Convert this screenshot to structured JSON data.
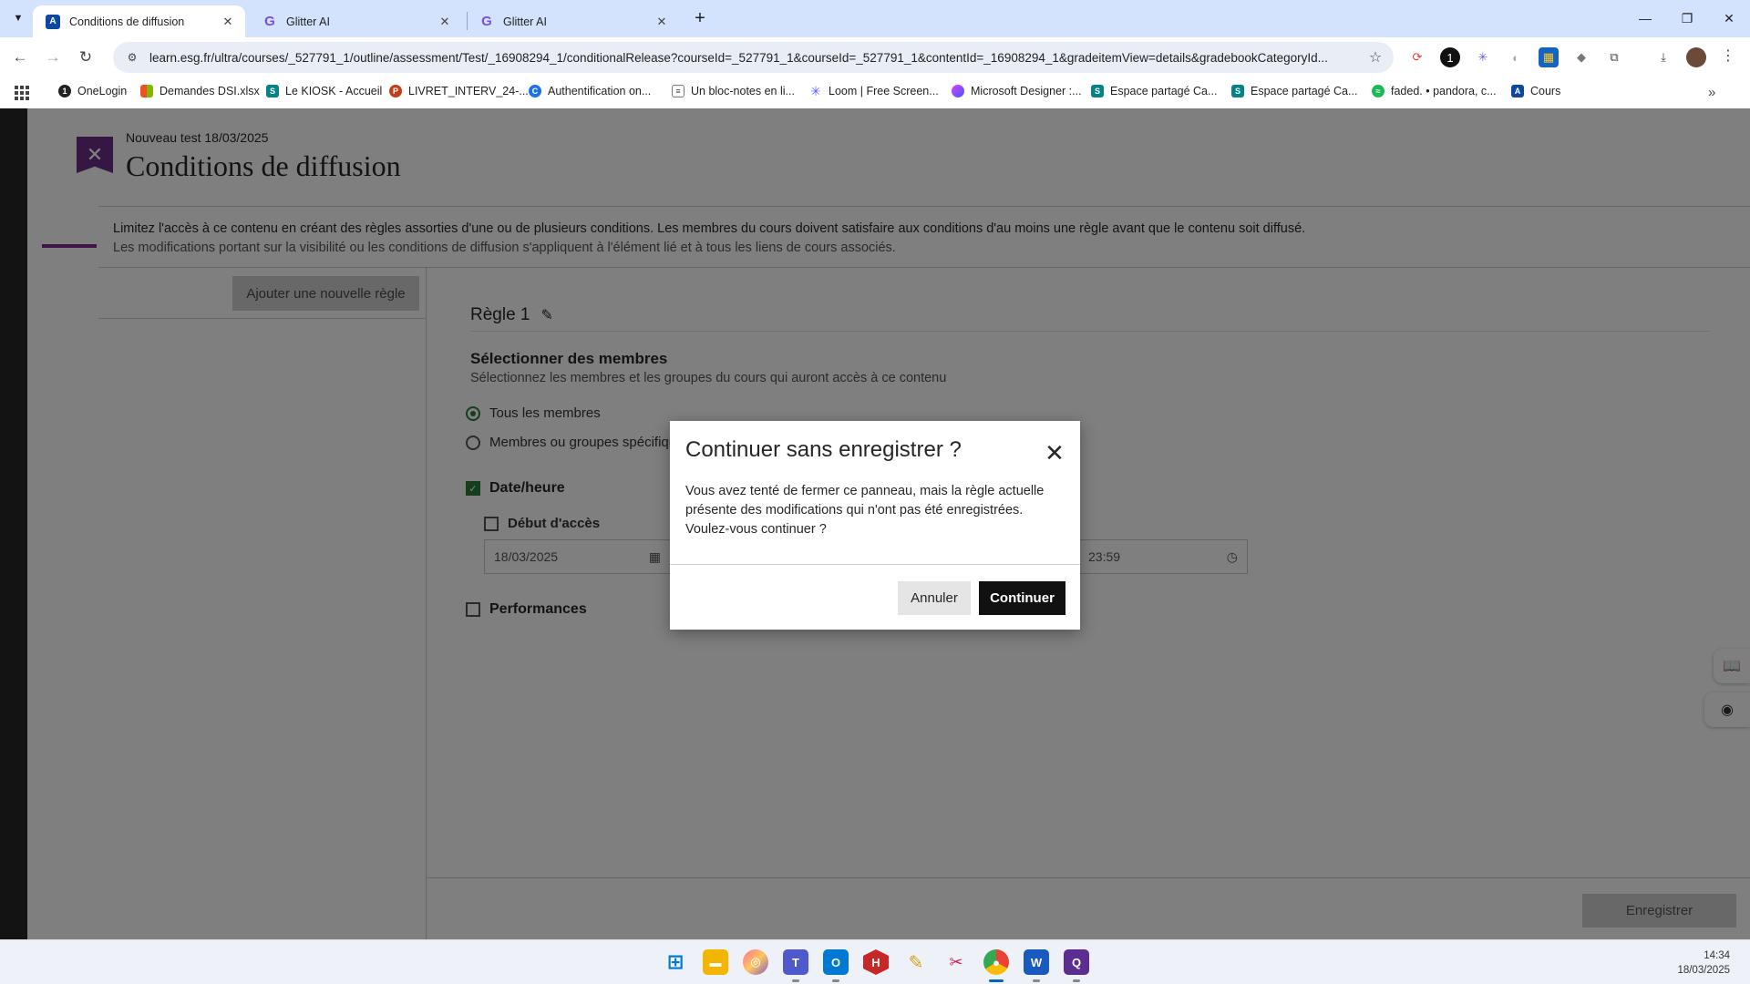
{
  "browser": {
    "tabs": [
      {
        "title": "Conditions de diffusion",
        "active": true,
        "favicon": "blackboard-icon"
      },
      {
        "title": "Glitter AI",
        "active": false,
        "favicon": "glitter-icon"
      },
      {
        "title": "Glitter AI",
        "active": false,
        "favicon": "glitter-icon"
      }
    ],
    "url": "learn.esg.fr/ultra/courses/_527791_1/outline/assessment/Test/_16908294_1/conditionalRelease?courseId=_527791_1&courseId=_527791_1&contentId=_16908294_1&gradeitemView=details&gradebookCategoryId...",
    "bookmarks": [
      {
        "label": "OneLogin",
        "color": "#222222",
        "glyph": "1"
      },
      {
        "label": "Demandes DSI.xlsx",
        "color": "#f25022",
        "glyph": "■"
      },
      {
        "label": "Le KIOSK - Accueil",
        "color": "#038387",
        "glyph": "S"
      },
      {
        "label": "LIVRET_INTERV_24-...",
        "color": "#c43e1c",
        "glyph": "P"
      },
      {
        "label": "Authentification on...",
        "color": "#1a73e8",
        "glyph": "C"
      },
      {
        "label": "Un bloc-notes en li...",
        "color": "#555555",
        "glyph": "▤"
      },
      {
        "label": "Loom | Free Screen...",
        "color": "#625df5",
        "glyph": "✳"
      },
      {
        "label": "Microsoft Designer :...",
        "color": "#b13ad0",
        "glyph": "◆"
      },
      {
        "label": "Espace partagé Ca...",
        "color": "#038387",
        "glyph": "S"
      },
      {
        "label": "Espace partagé Ca...",
        "color": "#038387",
        "glyph": "S"
      },
      {
        "label": "faded. • pandora, c...",
        "color": "#1db954",
        "glyph": "◉"
      },
      {
        "label": "Cours",
        "color": "#0d47a1",
        "glyph": "A"
      }
    ]
  },
  "page": {
    "breadcrumb": "Nouveau test 18/03/2025",
    "title": "Conditions de diffusion",
    "intro_line1": "Limitez l'accès à ce contenu en créant des règles assorties d'une ou de plusieurs conditions. Les membres du cours doivent satisfaire aux conditions d'au moins une règle avant que le contenu soit diffusé.",
    "intro_line2": "Les modifications portant sur la visibilité ou les conditions de diffusion s'appliquent à l'élément lié et à tous les liens de cours associés.",
    "add_rule_button": "Ajouter une nouvelle règle",
    "rule_title": "Règle 1",
    "members_section": {
      "title": "Sélectionner des membres",
      "subtitle": "Sélectionnez les membres et les groupes du cours qui auront accès à ce contenu",
      "option_all": "Tous les membres",
      "option_specific": "Membres ou groupes spécifiques",
      "selected": "Tous les membres"
    },
    "datetime": {
      "label": "Date/heure",
      "checked": true,
      "start_label": "Début d'accès",
      "start_checked": false,
      "start_date": "18/03/2025",
      "end_time": "23:59"
    },
    "performance": {
      "label": "Performances",
      "checked": false
    },
    "save_button": "Enregistrer"
  },
  "modal": {
    "title": "Continuer sans enregistrer ?",
    "body": "Vous avez tenté de fermer ce panneau, mais la règle actuelle présente des modifications qui n'ont pas été enregistrées. Voulez-vous continuer ?",
    "cancel_label": "Annuler",
    "continue_label": "Continuer"
  },
  "taskbar": {
    "time": "14:34",
    "date": "18/03/2025"
  }
}
